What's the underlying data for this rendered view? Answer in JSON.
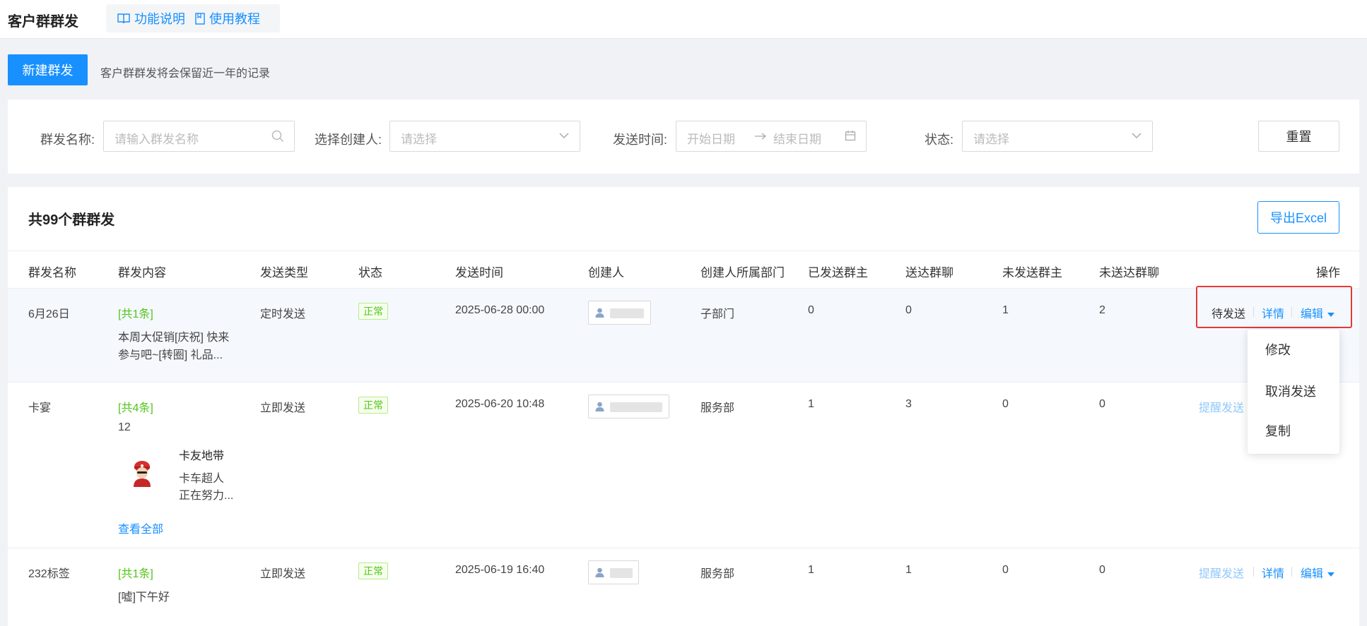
{
  "header": {
    "title": "客户群群发",
    "links": [
      {
        "label": "功能说明",
        "icon": "book-icon"
      },
      {
        "label": "使用教程",
        "icon": "bookmark-icon"
      }
    ]
  },
  "toolbar": {
    "new_label": "新建群发",
    "hint": "客户群群发将会保留近一年的记录"
  },
  "filters": {
    "name_label": "群发名称:",
    "name_placeholder": "请输入群发名称",
    "creator_label": "选择创建人:",
    "creator_placeholder": "请选择",
    "time_label": "发送时间:",
    "start_placeholder": "开始日期",
    "end_placeholder": "结束日期",
    "status_label": "状态:",
    "status_placeholder": "请选择",
    "reset_label": "重置"
  },
  "list": {
    "count_text": "共99个群群发",
    "export_label": "导出Excel"
  },
  "table": {
    "headers": [
      "群发名称",
      "群发内容",
      "发送类型",
      "状态",
      "发送时间",
      "创建人",
      "创建人所属部门",
      "已发送群主",
      "送达群聊",
      "未发送群主",
      "未送达群聊",
      "操作"
    ],
    "rows": [
      {
        "name": "6月26日",
        "count_tag": "[共1条]",
        "content_line1": "本周大促销[庆祝] 快来",
        "content_line2": "参与吧~[转圈] 礼品...",
        "send_type": "定时发送",
        "status": "正常",
        "time": "2025-06-28 00:00",
        "dept": "子部门",
        "sent_owners": "0",
        "delivered": "0",
        "unsent_owners": "1",
        "undelivered": "2",
        "op_status": "待发送",
        "op_detail": "详情",
        "op_edit": "编辑"
      },
      {
        "name": "卡宴",
        "count_tag": "[共4条]",
        "content_line1": "12",
        "card_title": "卡友地带",
        "card_desc1": "卡车超人",
        "card_desc2": "正在努力...",
        "view_all": "查看全部",
        "send_type": "立即发送",
        "status": "正常",
        "time": "2025-06-20 10:48",
        "dept": "服务部",
        "sent_owners": "1",
        "delivered": "3",
        "unsent_owners": "0",
        "undelivered": "0",
        "op_remind": "提醒发送"
      },
      {
        "name": "232标签",
        "count_tag": "[共1条]",
        "content_line1": "[嘘]下午好",
        "send_type": "立即发送",
        "status": "正常",
        "time": "2025-06-19 16:40",
        "dept": "服务部",
        "sent_owners": "1",
        "delivered": "1",
        "unsent_owners": "0",
        "undelivered": "0",
        "op_remind": "提醒发送",
        "op_detail": "详情",
        "op_edit": "编辑"
      }
    ]
  },
  "dropdown": {
    "items": [
      "修改",
      "取消发送",
      "复制"
    ]
  },
  "colors": {
    "primary": "#1890ff",
    "success": "#52c41a",
    "highlight": "#e53935"
  }
}
